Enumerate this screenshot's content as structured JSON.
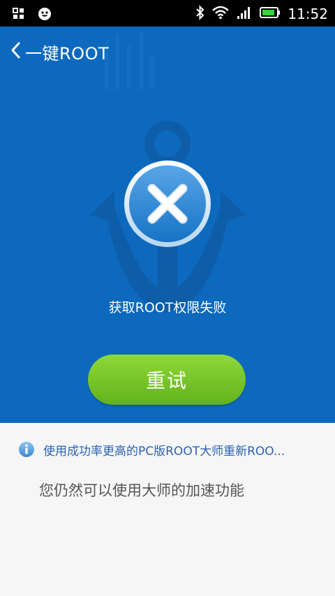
{
  "status_bar": {
    "time": "11:52",
    "icons": [
      "grid-icon",
      "smiley-icon",
      "bluetooth-icon",
      "wifi-icon",
      "signal-icon",
      "battery-icon"
    ]
  },
  "header": {
    "title": "一键ROOT",
    "back_icon": "chevron-left-icon"
  },
  "result": {
    "icon": "close-circle-icon",
    "message": "获取ROOT权限失败",
    "retry_label": "重试"
  },
  "tip": {
    "icon": "info-icon",
    "text": "使用成功率更高的PC版ROOT大师重新ROO..."
  },
  "note": {
    "text": "您仍然可以使用大师的加速功能"
  },
  "colors": {
    "hero_bg": "#0d69bd",
    "button_green": "#74c62a",
    "tip_blue": "#2a62b6",
    "page_bg": "#f6f6f6"
  }
}
